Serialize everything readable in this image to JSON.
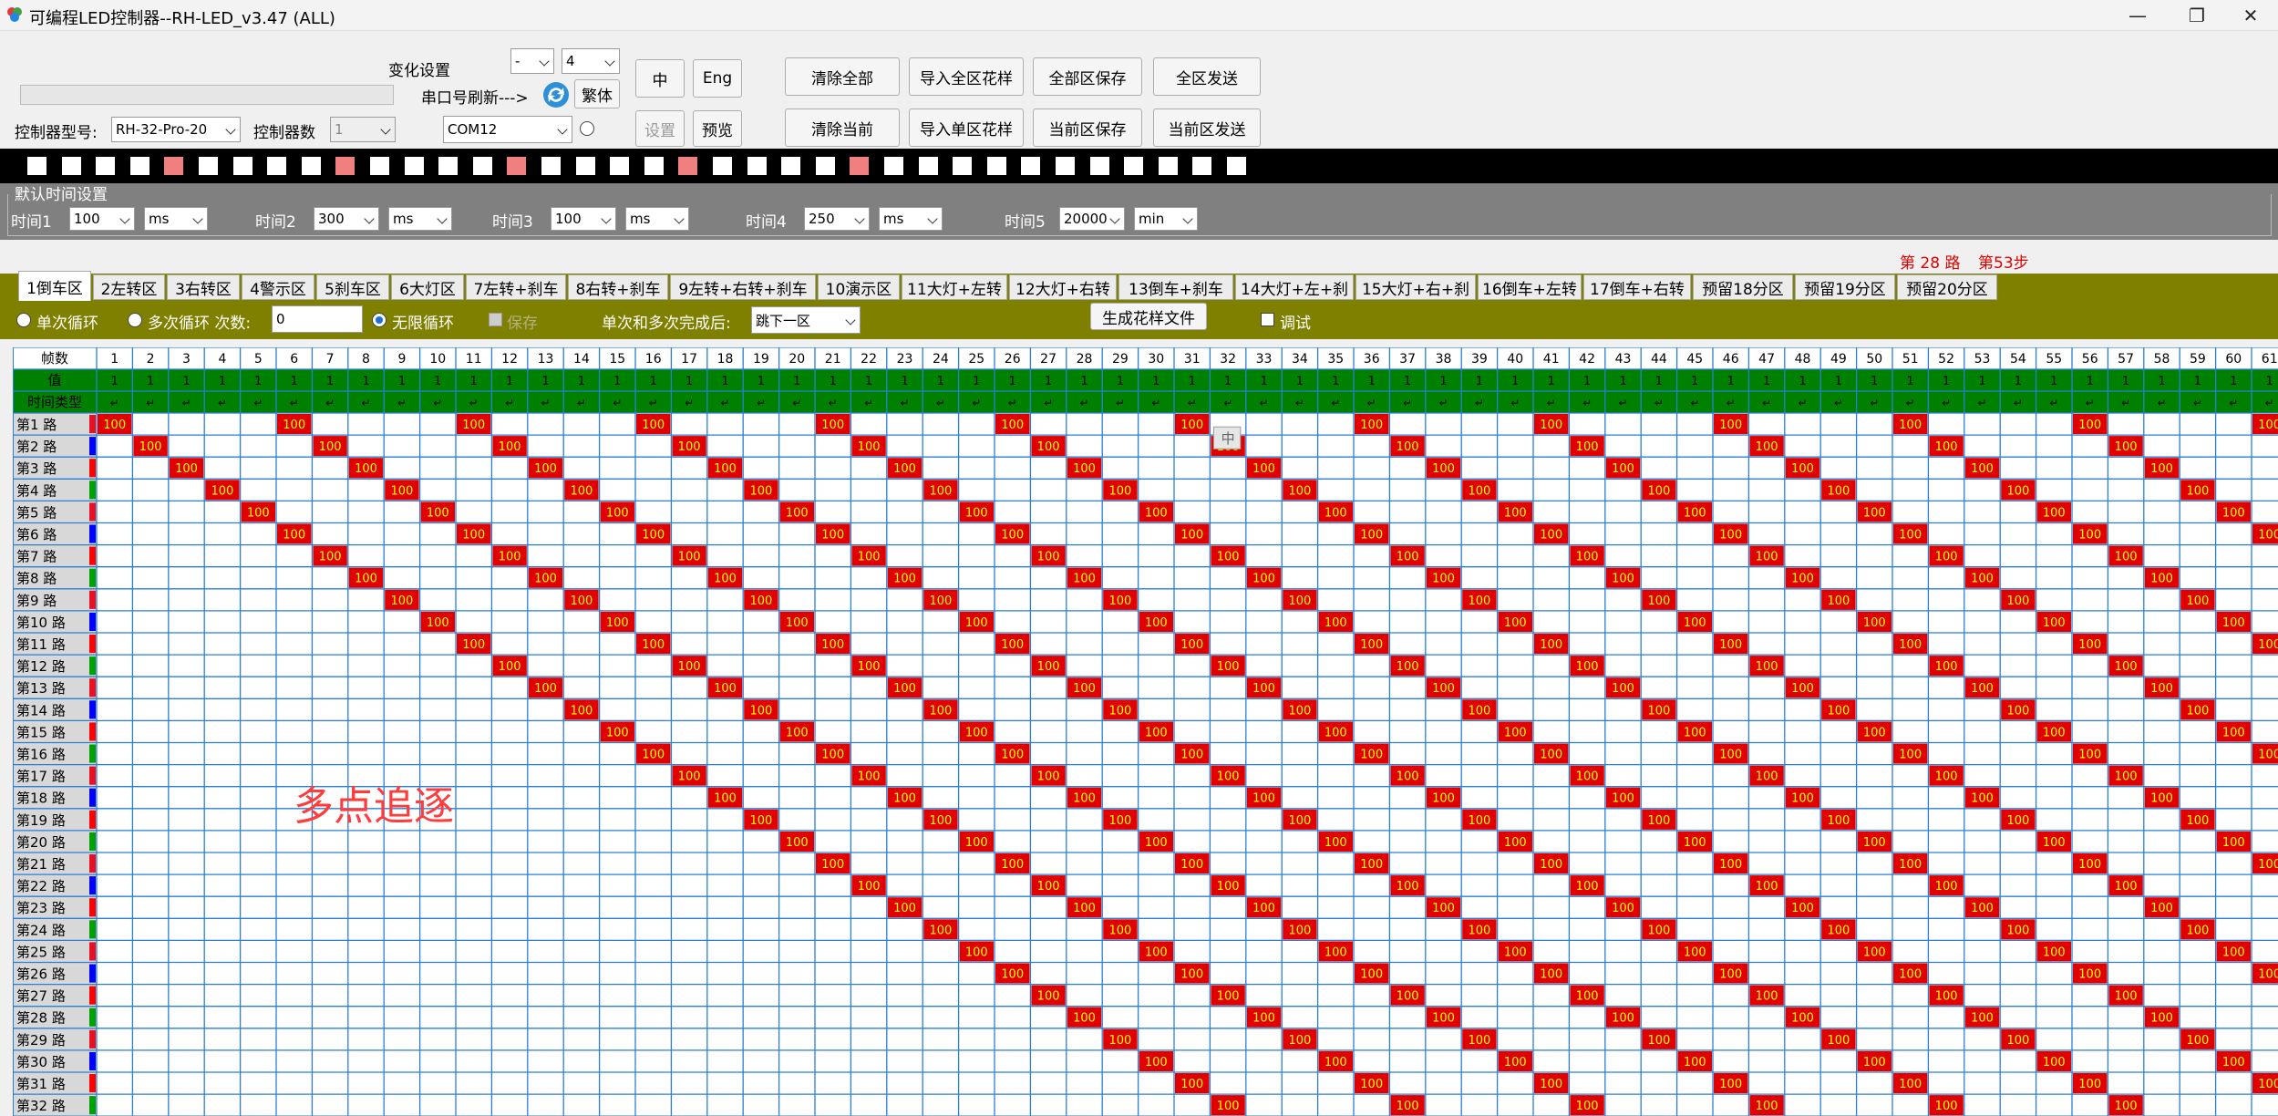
{
  "window": {
    "title": "可编程LED控制器--RH-LED_v3.47 (ALL)",
    "minimize": "—",
    "maximize": "❐",
    "close": "✕"
  },
  "top": {
    "change_setting_label": "变化设置",
    "change_select_a": "-",
    "change_select_b": "4",
    "port_refresh_label": "串口号刷新--->",
    "traditional_button": "繁体",
    "chinese_button": "中",
    "english_button": "Eng",
    "controller_model_label": "控制器型号:",
    "controller_model_value": "RH-32-Pro-20",
    "controller_count_label": "控制器数",
    "controller_count_value": "1",
    "com_port_value": "COM12",
    "settings_button": "设置",
    "preview_button": "预览",
    "clear_all_button": "清除全部",
    "import_all_button": "导入全区花样",
    "save_all_button": "全部区保存",
    "send_all_button": "全区发送",
    "clear_current_button": "清除当前",
    "import_single_button": "导入单区花样",
    "save_current_button": "当前区保存",
    "send_current_button": "当前区发送"
  },
  "indicators": [
    0,
    0,
    0,
    0,
    1,
    0,
    0,
    0,
    0,
    1,
    0,
    0,
    0,
    0,
    1,
    0,
    0,
    0,
    0,
    1,
    0,
    0,
    0,
    0,
    1,
    0,
    0,
    0,
    0,
    0,
    0,
    0,
    0,
    0,
    0,
    0
  ],
  "time_settings": {
    "title": "默认时间设置",
    "items": [
      {
        "label": "时间1",
        "value": "100",
        "unit": "ms"
      },
      {
        "label": "时间2",
        "value": "300",
        "unit": "ms"
      },
      {
        "label": "时间3",
        "value": "100",
        "unit": "ms"
      },
      {
        "label": "时间4",
        "value": "250",
        "unit": "ms"
      },
      {
        "label": "时间5",
        "value": "20000",
        "unit": "min"
      }
    ]
  },
  "status": {
    "route": "第 28 路",
    "step": "第53步"
  },
  "tabs": [
    "1倒车区",
    "2左转区",
    "3右转区",
    "4警示区",
    "5刹车区",
    "6大灯区",
    "7左转+刹车",
    "8右转+刹车",
    "9左转+右转+刹车",
    "10演示区",
    "11大灯+左转",
    "12大灯+右转",
    "13倒车+刹车",
    "14大灯+左+刹",
    "15大灯+右+刹",
    "16倒车+左转",
    "17倒车+右转",
    "预留18分区",
    "预留19分区",
    "预留20分区"
  ],
  "options": {
    "single_loop": "单次循环",
    "multi_loop": "多次循环 次数:",
    "loop_count": "0",
    "infinite_loop": "无限循环",
    "disabled_check": "保存",
    "after_done_label": "单次和多次完成后:",
    "after_done_value": "跳下一区",
    "generate_button": "生成花样文件",
    "debug_label": "调试"
  },
  "grid": {
    "header_frames": "帧数",
    "header_value": "值",
    "header_time_type": "时间类型",
    "value_text": "1",
    "time_type_text": "↵",
    "cell_text": "100",
    "row_label_prefix": "第",
    "row_label_suffix": " 路",
    "row_count": 32,
    "column_count": 61,
    "row_colors": [
      "#e81123",
      "#0000ff",
      "#ff0000",
      "#00a000"
    ],
    "floating_cell": "中"
  },
  "watermark": "多点追逐",
  "colors": {
    "titlebar": "#f3f3f3",
    "timepanel": "#808080",
    "olive": "#808000",
    "grid_green": "#008000",
    "grid_line": "#2a7fd4",
    "cell_red": "#e00000",
    "cell_text": "#ffff00"
  }
}
